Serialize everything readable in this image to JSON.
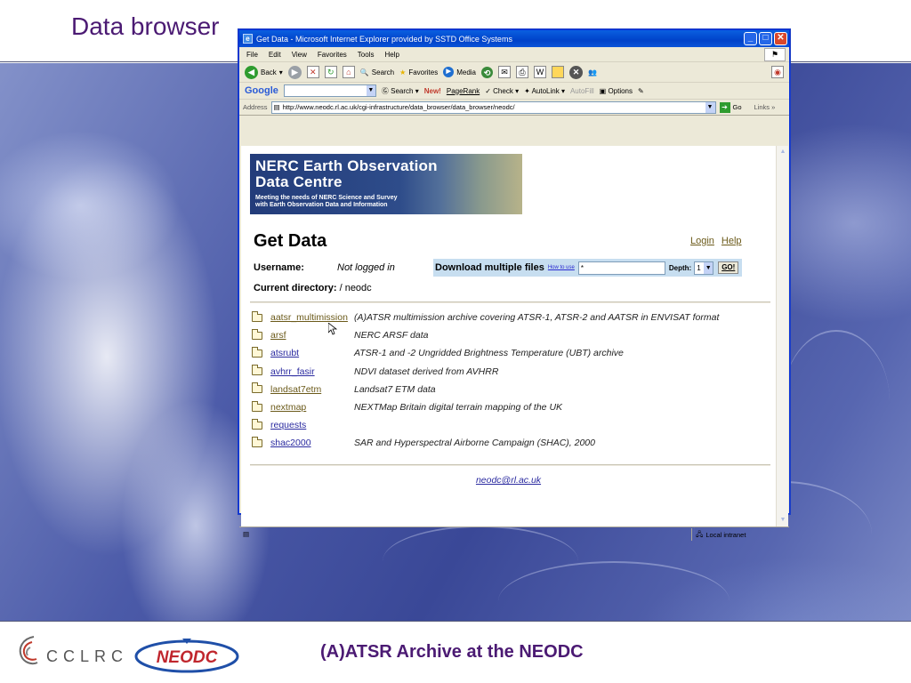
{
  "slide": {
    "title": "Data browser",
    "footer_caption": "(A)ATSR Archive at the NEODC",
    "cclrc_text": "CCLRC",
    "neodc_logo_text": "NEODC"
  },
  "window": {
    "title": "Get Data - Microsoft Internet Explorer provided by SSTD Office Systems",
    "menu": [
      "File",
      "Edit",
      "View",
      "Favorites",
      "Tools",
      "Help"
    ],
    "toolbar": {
      "back": "Back",
      "search": "Search",
      "favorites": "Favorites",
      "media": "Media"
    },
    "google_bar": {
      "logo": "Google",
      "search": "Search",
      "new_badge": "New!",
      "pagerank": "PageRank",
      "check": "Check",
      "autolink": "AutoLink",
      "autofill": "AutoFill",
      "options": "Options"
    },
    "address": {
      "label": "Address",
      "url": "http://www.neodc.rl.ac.uk/cgi-infrastructure/data_browser/data_browser/neodc/",
      "go": "Go",
      "links": "Links"
    },
    "status": {
      "zone": "Local intranet"
    }
  },
  "page": {
    "banner": {
      "line1": "NERC Earth Observation",
      "line2": "Data Centre",
      "sub1": "Meeting the needs of NERC Science and Survey",
      "sub2": "with Earth Observation Data and Information"
    },
    "heading": "Get Data",
    "links": {
      "login": "Login",
      "help": "Help"
    },
    "username_label": "Username:",
    "username_value": "Not logged in",
    "download": {
      "label": "Download multiple files",
      "howto": "How to use",
      "pattern": "*",
      "depth_label": "Depth:",
      "depth_value": "1",
      "go": "GO!"
    },
    "current_dir_label": "Current directory:",
    "current_dir_value": " / neodc",
    "directories": [
      {
        "name": "aatsr_multimission",
        "desc": "(A)ATSR multimission archive covering ATSR-1, ATSR-2 and AATSR in ENVISAT format"
      },
      {
        "name": "arsf",
        "desc": "NERC ARSF data"
      },
      {
        "name": "atsrubt",
        "desc": "ATSR-1 and -2 Ungridded Brightness Temperature (UBT) archive"
      },
      {
        "name": "avhrr_fasir",
        "desc": "NDVI dataset derived from AVHRR"
      },
      {
        "name": "landsat7etm",
        "desc": "Landsat7 ETM data"
      },
      {
        "name": "nextmap",
        "desc": "NEXTMap Britain digital terrain mapping of the UK"
      },
      {
        "name": "requests",
        "desc": ""
      },
      {
        "name": "shac2000",
        "desc": "SAR and Hyperspectral Airborne Campaign (SHAC), 2000"
      }
    ],
    "email": "neodc@rl.ac.uk"
  }
}
